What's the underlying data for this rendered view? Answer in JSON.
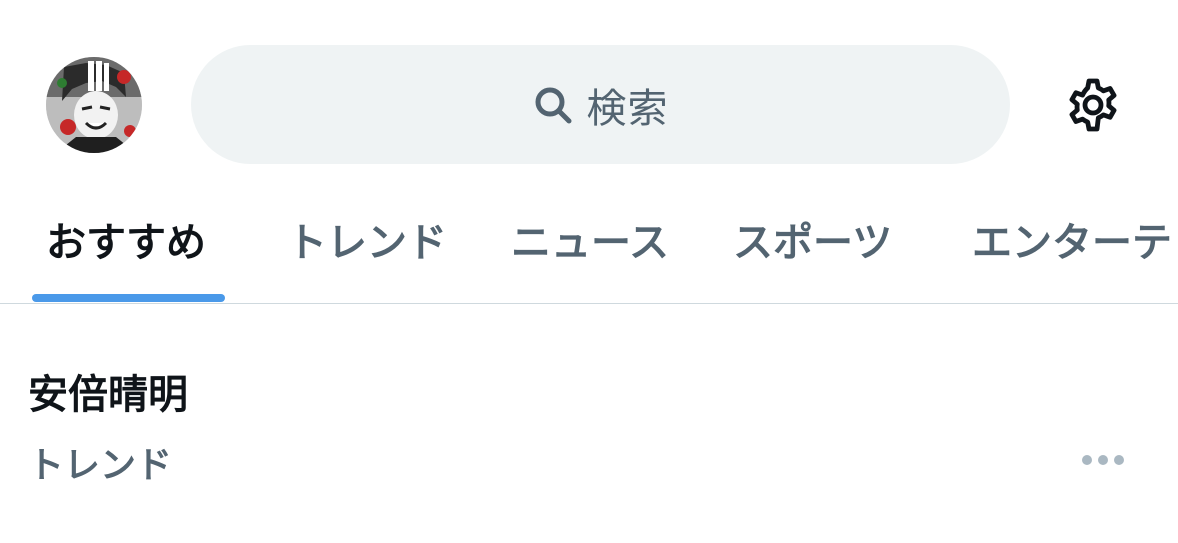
{
  "header": {
    "search": {
      "placeholder": "検索",
      "icon": "search-icon"
    },
    "settings_icon": "gear-icon",
    "avatar_icon": "avatar"
  },
  "tabs": [
    {
      "label": "おすすめ",
      "active": true
    },
    {
      "label": "トレンド",
      "active": false
    },
    {
      "label": "ニュース",
      "active": false
    },
    {
      "label": "スポーツ",
      "active": false
    },
    {
      "label": "エンターテ",
      "active": false
    }
  ],
  "trend": {
    "title": "安倍晴明",
    "category": "トレンド",
    "more_icon": "more-horizontal-icon"
  },
  "colors": {
    "accent": "#4a99e9",
    "search_bg": "#eff3f4",
    "secondary_text": "#536471",
    "primary_text": "#0f1419",
    "divider": "#cfd9de"
  }
}
